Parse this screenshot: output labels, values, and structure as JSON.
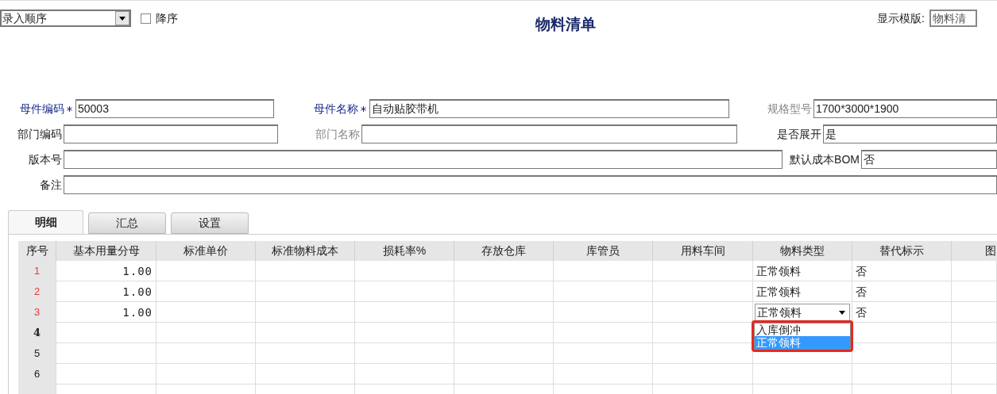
{
  "toolbar": {
    "sort_select": {
      "value": "录入顺序"
    },
    "descending": {
      "label": "降序",
      "checked": false
    },
    "title": "物料清单",
    "template": {
      "label": "显示模版:",
      "value": "物料清"
    }
  },
  "form": {
    "fields": [
      {
        "label": "母件编码",
        "kind": "required",
        "value": "50003"
      },
      {
        "label": "母件名称",
        "kind": "required",
        "value": "自动贴胶带机"
      },
      {
        "label": "规格型号",
        "kind": "disabled",
        "value": "1700*3000*1900"
      },
      {
        "label": "部门编码",
        "kind": "normal"
      },
      {
        "label": "部门名称",
        "kind": "disabled"
      },
      {
        "label": "是否展开",
        "kind": "normal",
        "value": "是"
      },
      {
        "label": "版本号",
        "kind": "normal"
      },
      {
        "label": "默认成本BOM",
        "kind": "normal",
        "value": "否"
      },
      {
        "label": "备注",
        "kind": "normal"
      }
    ]
  },
  "tabs": [
    {
      "label": "明细",
      "selected": true
    },
    {
      "label": "汇总",
      "selected": false
    },
    {
      "label": "设置",
      "selected": false
    }
  ],
  "table": {
    "columns": [
      "序号",
      "基本用量分母",
      "标准单价",
      "标准物料成本",
      "损耗率%",
      "存放仓库",
      "库管员",
      "用料车间",
      "物料类型",
      "替代标示",
      "图"
    ],
    "rows": [
      {
        "no": "1",
        "color": "#e53935",
        "current": false,
        "base_qty": "1.00",
        "material_type": "正常领料",
        "substitute": "否"
      },
      {
        "no": "2",
        "color": "#e53935",
        "current": false,
        "base_qty": "1.00",
        "material_type": "正常领料",
        "substitute": "否"
      },
      {
        "no": "3",
        "color": "#e53935",
        "current": false,
        "base_qty": "1.00",
        "material_type": "正常领料",
        "substitute": "否",
        "editing": true
      },
      {
        "no": "4",
        "color": "#222222",
        "current": true
      },
      {
        "no": "5",
        "color": "#222222",
        "current": false
      },
      {
        "no": "6",
        "color": "#222222",
        "current": false
      }
    ],
    "dropdown": {
      "options": [
        {
          "label": "入库倒冲",
          "selected": false
        },
        {
          "label": "正常领料",
          "selected": true
        }
      ]
    }
  }
}
